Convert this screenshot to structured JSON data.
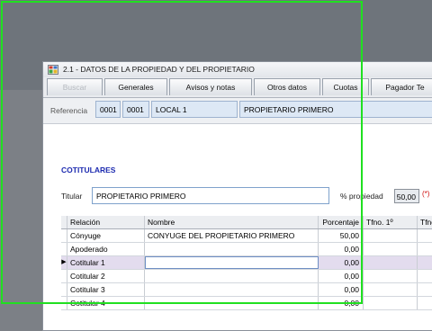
{
  "window": {
    "title": "2.1 - DATOS DE LA PROPIEDAD Y DEL PROPIETARIO"
  },
  "tabs": [
    {
      "label": "Buscar",
      "disabled": true
    },
    {
      "label": "Generales"
    },
    {
      "label": "Avisos y notas"
    },
    {
      "label": "Otros datos"
    },
    {
      "label": "Cuotas"
    },
    {
      "label": "Pagador Te"
    }
  ],
  "reference": {
    "label": "Referencia",
    "code1": "0001",
    "code2": "0001",
    "property": "LOCAL 1",
    "owner": "PROPIETARIO PRIMERO"
  },
  "cotitulares": {
    "section_title": "COTITULARES",
    "titular_label": "Titular",
    "titular_value": "PROPIETARIO PRIMERO",
    "pct_label": "% propiedad",
    "pct_value": "50,00",
    "required_mark": "(*)"
  },
  "grid": {
    "columns": [
      "Relación",
      "Nombre",
      "Porcentaje",
      "Tfno. 1º",
      "Tfno"
    ],
    "rows": [
      {
        "relacion": "Cónyuge",
        "nombre": "CONYUGE DEL PROPIETARIO PRIMERO",
        "porcentaje": "50,00",
        "selected": false
      },
      {
        "relacion": "Apoderado",
        "nombre": "",
        "porcentaje": "0,00",
        "selected": false
      },
      {
        "relacion": "Cotitular 1",
        "nombre": "",
        "porcentaje": "0,00",
        "selected": true
      },
      {
        "relacion": "Cotitular 2",
        "nombre": "",
        "porcentaje": "0,00",
        "selected": false
      },
      {
        "relacion": "Cotitular 3",
        "nombre": "",
        "porcentaje": "0,00",
        "selected": false
      },
      {
        "relacion": "Cotitular 4",
        "nombre": "",
        "porcentaje": "0,00",
        "selected": false
      }
    ],
    "current_row_marker": "▶"
  },
  "colors": {
    "selection_frame": "#20e020",
    "section_title": "#1d2bb0",
    "required": "#d01010"
  }
}
